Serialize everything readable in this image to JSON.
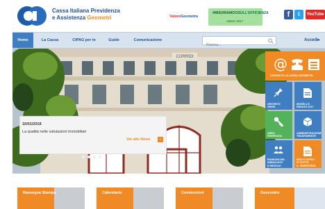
{
  "header": {
    "brand_line1": "Cassa Italiana Previdenza",
    "brand_line2_a": "e Assistenza",
    "brand_line2_b": "Geometri",
    "valore_a": "Valore",
    "valore_b": "Geometra",
    "campaign_prefix": "#MISURIAMOCI",
    "campaign_highlight": "SULL'EFFICIENZA",
    "campaign_year": "ANNO 2017",
    "social": {
      "facebook": "f",
      "twitter": "t",
      "youtube": "YouTube"
    }
  },
  "nav": {
    "items": [
      "Home",
      "La Cassa",
      "CIPAG per te",
      "Guide",
      "Comunicazione"
    ],
    "search_placeholder": "Ricerca...",
    "login": "Accedi"
  },
  "hero": {
    "building_sign": "CORRIDI",
    "news_date": "16/01/2018",
    "news_text": "La qualità nelle valutazioni immobiliari",
    "news_more": "Vai alle News"
  },
  "tiles": {
    "contact": "CONTATTA LA CASSA GEOMETRI",
    "archivio": [
      "ARCHIVIO",
      "NEWS"
    ],
    "modello": [
      "MODELLO",
      "REDDITI 2017"
    ],
    "area": [
      "AREA",
      "RISERVATA"
    ],
    "amm": [
      "AMMINISTRAZIONE",
      "TRASPARENTE"
    ],
    "riunioni": [
      "RIUNIONI DEL",
      "SINDACATO",
      "E REGOLE"
    ],
    "sedi": [
      "SEDI E UFFICI",
      "DI TUTTO",
      "IL TERRITORIO"
    ]
  },
  "bottom": [
    "Rassegna Stampa",
    "Calendario",
    "Convenzioni",
    "Geocentro"
  ],
  "colors": {
    "brand_blue": "#1f4e91",
    "accent_orange": "#f08a24",
    "tile_blue": "#3f7fc1",
    "tile_green": "#52b35a"
  }
}
